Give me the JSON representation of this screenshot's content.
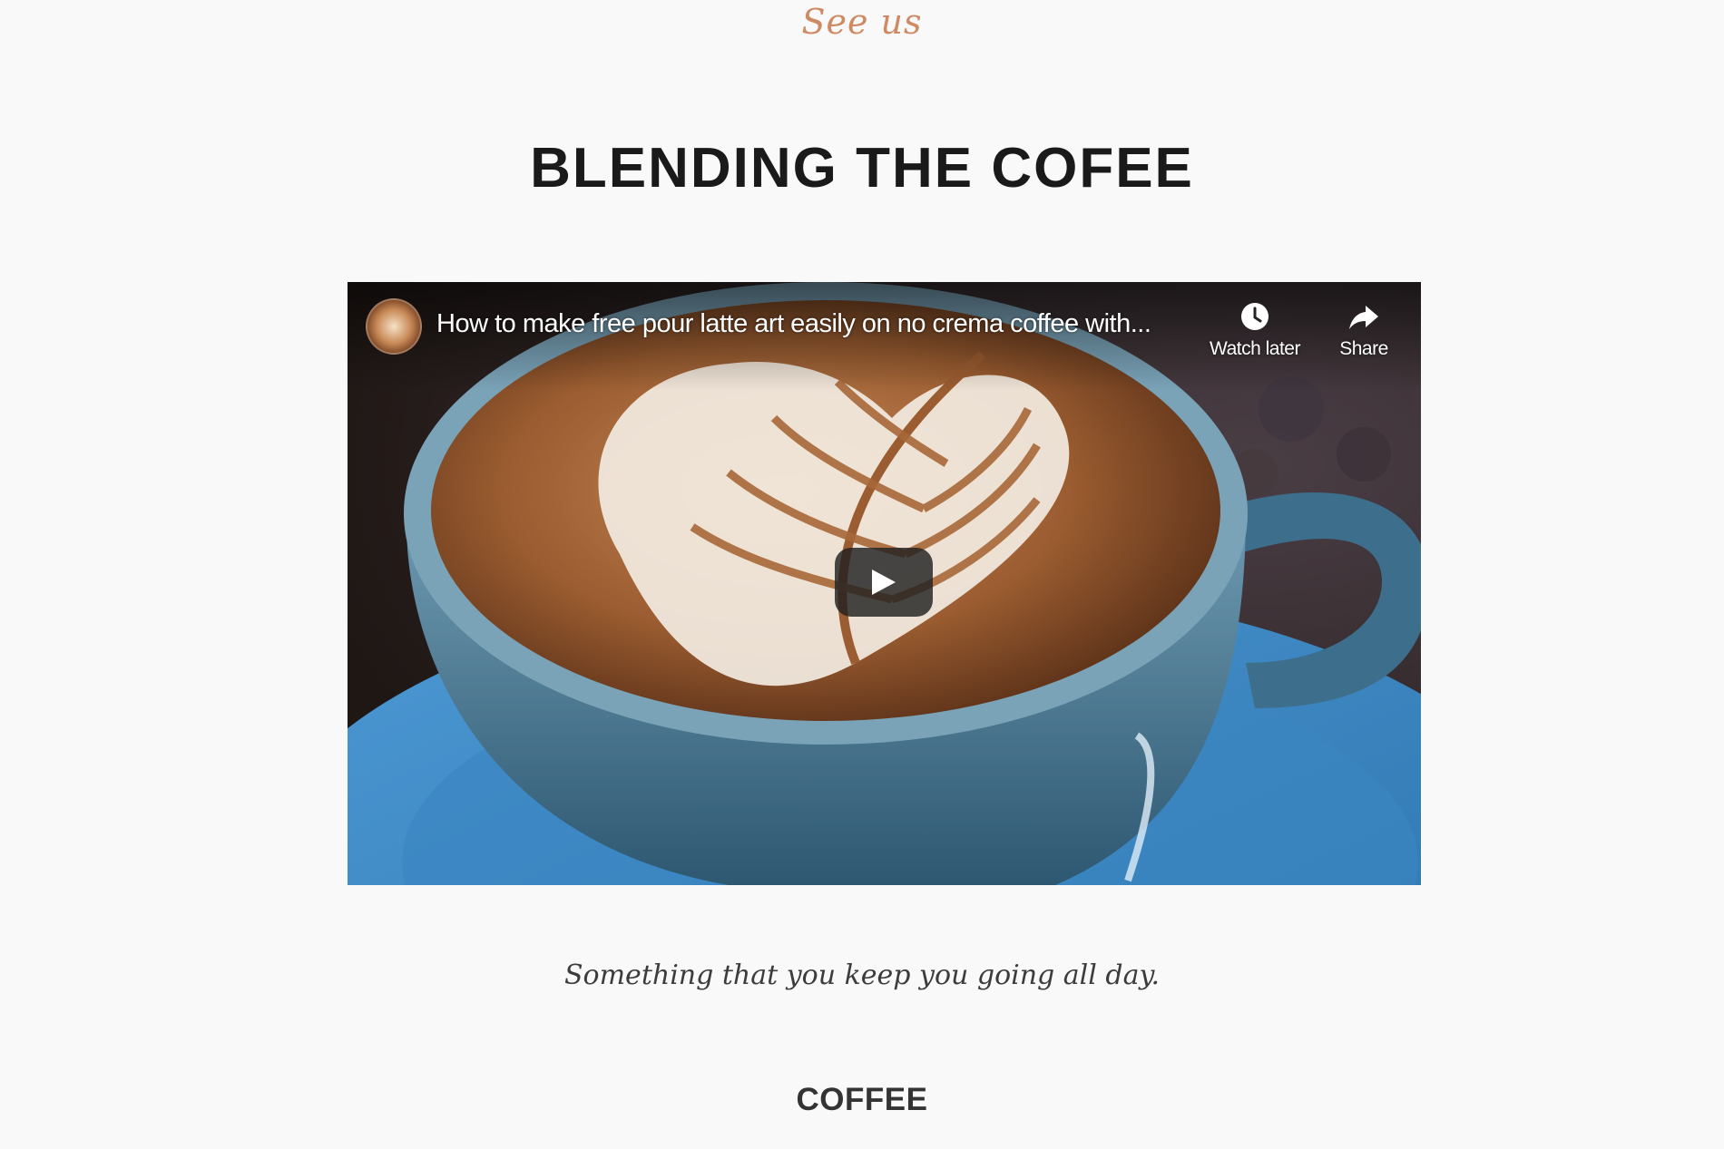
{
  "header": {
    "kicker": "See us",
    "title": "BLENDING THE COFEE"
  },
  "video": {
    "title": "How to make free pour latte art easily on no crema coffee with...",
    "watch_later_label": "Watch later",
    "share_label": "Share",
    "colors": {
      "saucer": "#3b86c4",
      "cup": "#4f7f99",
      "foam": "#f3ebe2",
      "crema": "#9a5c30"
    }
  },
  "tagline": "Something that you keep you going all day.",
  "section": {
    "label": "COFFEE"
  },
  "colors": {
    "accent": "#cf8a63",
    "background": "#f9f9f9",
    "title": "#1a1a1a"
  }
}
